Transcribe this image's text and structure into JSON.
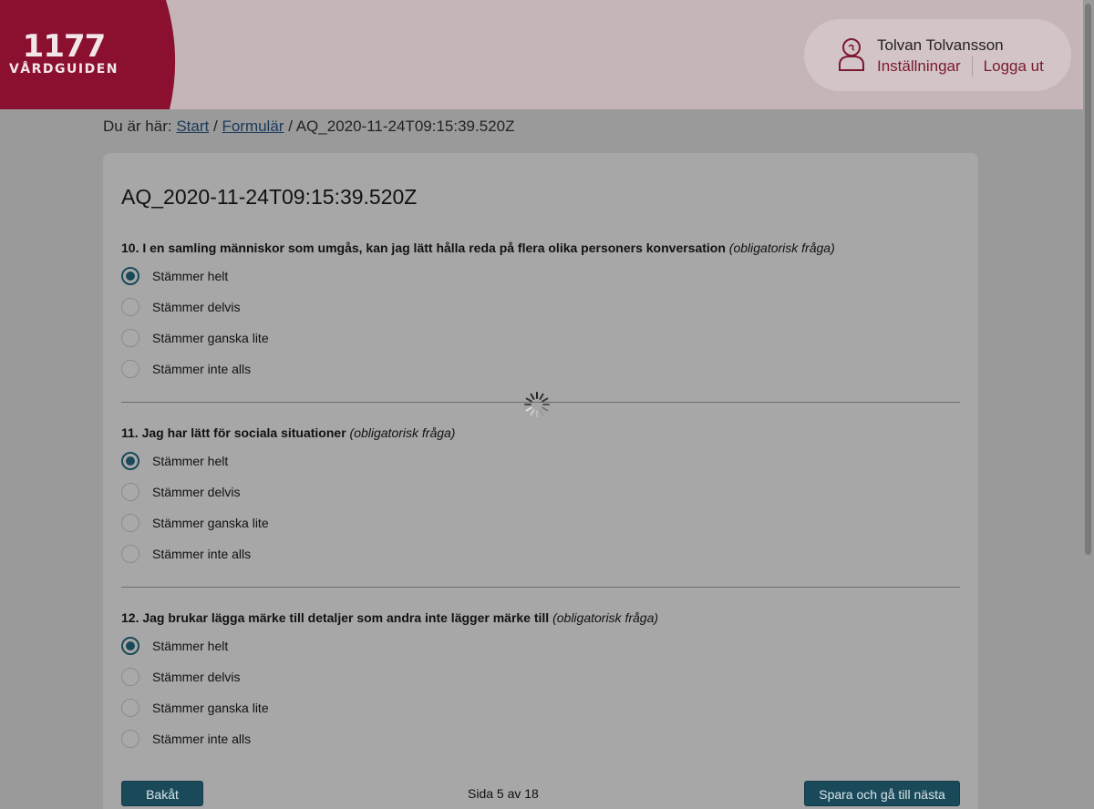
{
  "header": {
    "logo_number": "1177",
    "logo_name": "VÅRDGUIDEN",
    "user_name": "Tolvan Tolvansson",
    "settings_link": "Inställningar",
    "logout_link": "Logga ut",
    "brand_color": "#8b1030"
  },
  "breadcrumb": {
    "prefix": "Du är här:",
    "items": [
      "Start",
      "Formulär"
    ],
    "current": "AQ_2020-11-24T09:15:39.520Z",
    "separator": "/"
  },
  "page": {
    "title": "AQ_2020-11-24T09:15:39.520Z"
  },
  "questions": [
    {
      "label": "10. I en samling människor som umgås, kan jag lätt hålla reda på flera olika personers konversation",
      "required_note": "(obligatorisk fråga)",
      "options": [
        "Stämmer helt",
        "Stämmer delvis",
        "Stämmer ganska lite",
        "Stämmer inte alls"
      ],
      "selected": "Stämmer helt"
    },
    {
      "label": "11. Jag har lätt för sociala situationer",
      "required_note": "(obligatorisk fråga)",
      "options": [
        "Stämmer helt",
        "Stämmer delvis",
        "Stämmer ganska lite",
        "Stämmer inte alls"
      ],
      "selected": "Stämmer helt"
    },
    {
      "label": "12. Jag brukar lägga märke till detaljer som andra inte lägger märke till",
      "required_note": "(obligatorisk fråga)",
      "options": [
        "Stämmer helt",
        "Stämmer delvis",
        "Stämmer ganska lite",
        "Stämmer inte alls"
      ],
      "selected": "Stämmer helt"
    }
  ],
  "footer": {
    "back_label": "Bakåt",
    "page_indicator": "Sida 5 av 18",
    "next_label": "Spara och gå till nästa"
  }
}
